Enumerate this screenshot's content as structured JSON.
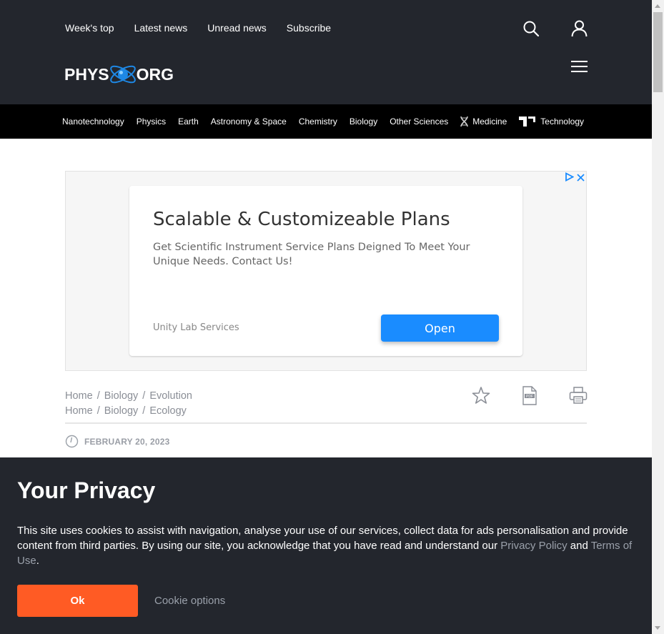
{
  "header": {
    "top_links": [
      "Week's top",
      "Latest news",
      "Unread news",
      "Subscribe"
    ],
    "logo": {
      "left": "PHYS",
      "right": "ORG"
    },
    "icons": [
      "search-icon",
      "user-icon",
      "hamburger-menu-icon"
    ]
  },
  "categories": [
    {
      "label": "Nanotechnology"
    },
    {
      "label": "Physics"
    },
    {
      "label": "Earth"
    },
    {
      "label": "Astronomy & Space"
    },
    {
      "label": "Chemistry"
    },
    {
      "label": "Biology"
    },
    {
      "label": "Other Sciences"
    },
    {
      "label": "Medicine",
      "icon": "dna-icon"
    },
    {
      "label": "Technology",
      "icon": "techxplore-icon"
    }
  ],
  "ad": {
    "title": "Scalable & Customizeable Plans",
    "description": "Get Scientific Instrument Service Plans Deigned To Meet Your Unique Needs. Contact Us!",
    "advertiser": "Unity Lab Services",
    "cta": "Open"
  },
  "breadcrumbs": [
    [
      "Home",
      "Biology",
      "Evolution"
    ],
    [
      "Home",
      "Biology",
      "Ecology"
    ]
  ],
  "article": {
    "date": "FEBRUARY 20, 2023",
    "tools": [
      "bookmark-star-icon",
      "pdf-icon",
      "print-icon"
    ]
  },
  "privacy": {
    "title": "Your Privacy",
    "text_before": "This site uses cookies to assist with navigation, analyse your use of our services, collect data for ads personalisation and provide content from third parties. By using our site, you acknowledge that you have read and understand our ",
    "privacy_policy": "Privacy Policy",
    "and": " and ",
    "terms": "Terms of Use",
    "end": ".",
    "ok": "Ok",
    "cookie_options": "Cookie options"
  },
  "colors": {
    "header_bg": "#23262d",
    "nav_bg": "#000000",
    "ok_button": "#ff5b24",
    "ad_button": "#1a8cff",
    "logo_accent": "#1e88e5"
  }
}
